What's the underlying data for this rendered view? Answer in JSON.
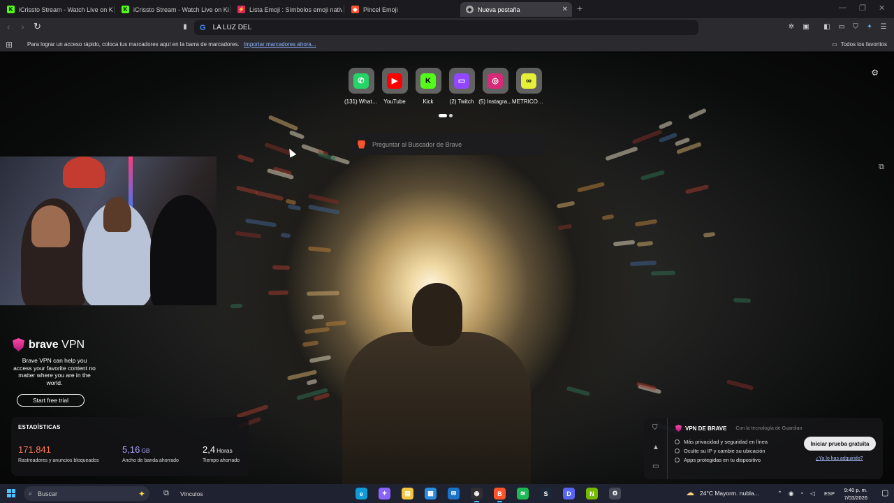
{
  "tabs": [
    {
      "title": "iCrissto Stream - Watch Live on Kick",
      "favicon": "kick-icon",
      "color": "#53fc18"
    },
    {
      "title": "iCrissto Stream - Watch Live on Kick",
      "favicon": "kick-icon",
      "color": "#53fc18"
    },
    {
      "title": "Lista Emoji : Símbolos emoji nativas e",
      "favicon": "emoji-site-icon",
      "color": "#e0245e"
    },
    {
      "title": "Pincel Emoji",
      "favicon": "brave-icon",
      "color": "#fb542b"
    },
    {
      "title": "Nueva pestaña",
      "favicon": "brave-shield-icon",
      "active": true
    }
  ],
  "address_bar": {
    "value": "LA LUZ DEL"
  },
  "bookmarks_bar": {
    "message": "Para lograr un acceso rápido, coloca tus marcadores aquí en la barra de marcadores.",
    "import_link": "Importar marcadores ahora...",
    "all_favorites": "Todos los favoritos"
  },
  "shortcuts": [
    {
      "label": "(131) Whats...",
      "icon": "whatsapp-icon",
      "bg": "#25d366",
      "glyph": "✆"
    },
    {
      "label": "YouTube",
      "icon": "youtube-icon",
      "bg": "#ff0000",
      "glyph": "▶"
    },
    {
      "label": "Kick",
      "icon": "kick-icon",
      "bg": "#53fc18",
      "glyph": "K"
    },
    {
      "label": "(2) Twitch",
      "icon": "twitch-icon",
      "bg": "#9146ff",
      "glyph": "▭"
    },
    {
      "label": "(5) Instagra...",
      "icon": "instagram-icon",
      "bg": "#d62976",
      "glyph": "◎"
    },
    {
      "label": "METRICOO...",
      "icon": "metricool-icon",
      "bg": "#e5f03a",
      "glyph": "∞"
    }
  ],
  "search": {
    "placeholder": "Preguntar al Buscador de Brave"
  },
  "vpn_promo": {
    "brand": "brave",
    "brand_suffix": "VPN",
    "description": "Brave VPN can help you access your favorite content no matter where you are in the world.",
    "button": "Start free trial"
  },
  "stats": {
    "title": "ESTADÍSTICAS",
    "items": [
      {
        "value": "171.841",
        "unit": "",
        "caption": "Rastreadores y anuncios bloqueados",
        "color": "#ff7a55"
      },
      {
        "value": "5,16",
        "unit": "GB",
        "caption": "Ancho de banda ahorrado",
        "color": "#a9a4ff"
      },
      {
        "value": "2,4",
        "unit": "Horas",
        "caption": "Tiempo ahorrado",
        "color": "#ffffff"
      }
    ]
  },
  "vpn_card": {
    "title": "VPN DE BRAVE",
    "powered_by": "Con la tecnología de Guardian",
    "features": [
      "Más privacidad y seguridad en línea",
      "Oculte su IP y cambie su ubicación",
      "Apps protegidas en tu dispositivo"
    ],
    "cta": "Iniciar prueba gratuita",
    "already": "¿Ya lo has adquirido?"
  },
  "taskbar": {
    "search_placeholder": "Buscar",
    "links_label": "Vínculos",
    "weather": "24°C  Mayorm. nubla...",
    "language": "ESP",
    "time": "9:40 p. m.",
    "date": "7/03/2026",
    "apps": [
      {
        "name": "edge-icon",
        "color": "#0f9bd7",
        "glyph": "e"
      },
      {
        "name": "copilot-icon",
        "color": "#8a63ff",
        "glyph": "✦"
      },
      {
        "name": "file-explorer-icon",
        "color": "#f4c542",
        "glyph": "▤"
      },
      {
        "name": "store-icon",
        "color": "#2b8de0",
        "glyph": "▦"
      },
      {
        "name": "outlook-icon",
        "color": "#1a73c9",
        "glyph": "✉"
      },
      {
        "name": "obs-icon",
        "color": "#302e31",
        "glyph": "◉",
        "active": true
      },
      {
        "name": "brave-browser-icon",
        "color": "#fb542b",
        "glyph": "B",
        "active": true
      },
      {
        "name": "spotify-icon",
        "color": "#1db954",
        "glyph": "≋"
      },
      {
        "name": "steam-icon",
        "color": "#1b2838",
        "glyph": "S"
      },
      {
        "name": "discord-icon",
        "color": "#5865f2",
        "glyph": "D"
      },
      {
        "name": "nvidia-icon",
        "color": "#76b900",
        "glyph": "N"
      },
      {
        "name": "settings-icon",
        "color": "#444a5a",
        "glyph": "⚙"
      }
    ]
  }
}
